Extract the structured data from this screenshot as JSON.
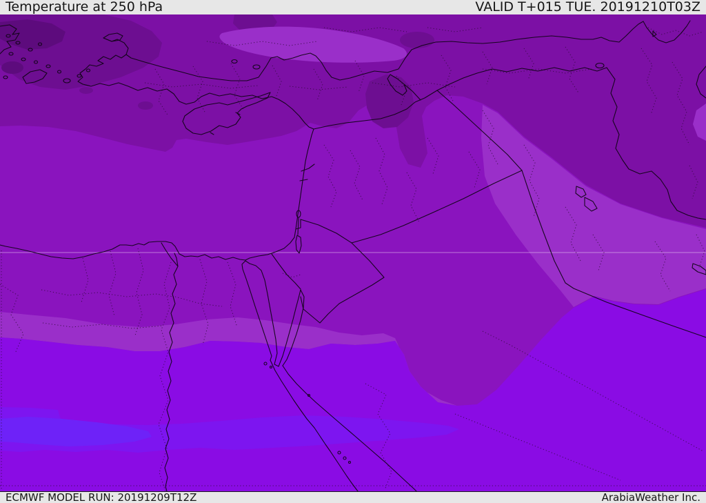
{
  "header": {
    "title": "Temperature at 250 hPa",
    "valid_label": "VALID T+015 TUE. 20191210T03Z"
  },
  "footer": {
    "model_run_label": "ECMWF MODEL RUN: 20191209T12Z",
    "credit_label": "ArabiaWeather Inc."
  },
  "map": {
    "description": "ECMWF 250 hPa temperature shading over the Eastern Mediterranean and Middle East",
    "parameter": "Temperature",
    "level": "250 hPa",
    "colors": {
      "band_darkest": "#5d0b7d",
      "band_darker": "#6d0e91",
      "band_dark": "#7c10a5",
      "band_medium": "#8a14be",
      "band_light": "#9a2fc9",
      "band_bright": "#8a0ce4",
      "band_brighter": "#7d15f0",
      "band_violet_blue": "#6e22f8",
      "coastline": "#0d0312",
      "admin_boundary": "#2a0a33",
      "graticule": "#e9ccf2",
      "chrome_background": "#e7e7e7",
      "chrome_text": "#151515"
    }
  }
}
